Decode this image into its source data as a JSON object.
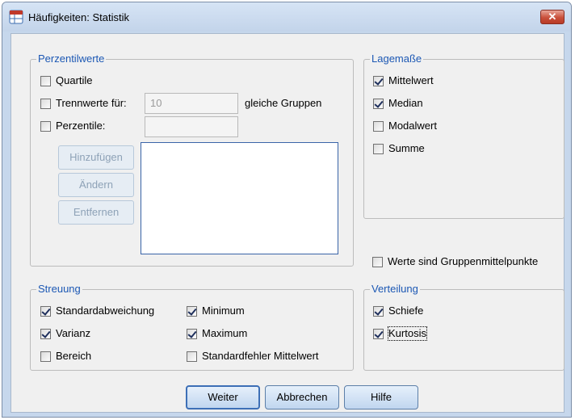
{
  "window": {
    "title": "Häufigkeiten: Statistik",
    "close_label": "✕"
  },
  "perzentil": {
    "legend": "Perzentilwerte",
    "quartile": {
      "label": "Quartile",
      "checked": false
    },
    "trennwerte": {
      "label": "Trennwerte für:",
      "checked": false,
      "value": "10",
      "suffix": "gleiche Gruppen"
    },
    "perzentile": {
      "label": "Perzentile:",
      "checked": false,
      "value": ""
    },
    "buttons": {
      "add": "Hinzufügen",
      "change": "Ändern",
      "remove": "Entfernen"
    }
  },
  "lagemasse": {
    "legend": "Lagemaße",
    "items": [
      {
        "label": "Mittelwert",
        "checked": true
      },
      {
        "label": "Median",
        "checked": true
      },
      {
        "label": "Modalwert",
        "checked": false
      },
      {
        "label": "Summe",
        "checked": false
      }
    ]
  },
  "gruppenmittelpunkte": {
    "label": "Werte sind Gruppenmittelpunkte",
    "checked": false
  },
  "streuung": {
    "legend": "Streuung",
    "items": [
      {
        "label": "Standardabweichung",
        "checked": true
      },
      {
        "label": "Minimum",
        "checked": true
      },
      {
        "label": "Varianz",
        "checked": true
      },
      {
        "label": "Maximum",
        "checked": true
      },
      {
        "label": "Bereich",
        "checked": false
      },
      {
        "label": "Standardfehler Mittelwert",
        "checked": false
      }
    ]
  },
  "verteilung": {
    "legend": "Verteilung",
    "items": [
      {
        "label": "Schiefe",
        "checked": true
      },
      {
        "label": "Kurtosis",
        "checked": true
      }
    ]
  },
  "footer": {
    "continue": "Weiter",
    "cancel": "Abbrechen",
    "help": "Hilfe"
  }
}
